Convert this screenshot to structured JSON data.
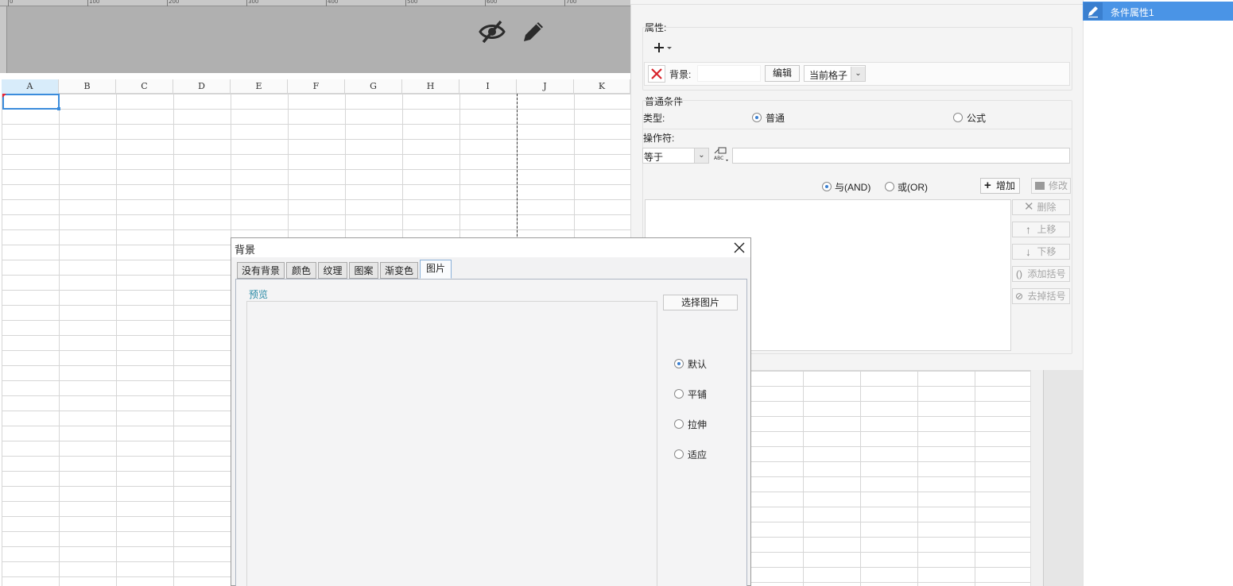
{
  "header": {
    "ruler_labels": [
      "0",
      "100",
      "200",
      "300",
      "400",
      "500",
      "600",
      "700"
    ],
    "hide_icon": "eye-slash-icon",
    "edit_icon": "pencil-icon"
  },
  "sheet": {
    "columns": [
      "A",
      "B",
      "C",
      "D",
      "E",
      "F",
      "G",
      "H",
      "I",
      "J",
      "K"
    ],
    "selected_cell": "A1"
  },
  "cond_panel": {
    "attr_label": "属性:",
    "add_icon": "plus-icon",
    "bg_remove_icon": "red-x-icon",
    "bg_label": "背景:",
    "bg_value": "",
    "edit_btn": "编辑",
    "scope_value": "当前格子",
    "normal_condition_title": "普通条件",
    "type_label": "类型:",
    "type_normal": "普通",
    "type_formula": "公式",
    "type_selected": "普通",
    "operator_label": "操作符:",
    "operator_value": "等于",
    "operand_value": "",
    "and_label": "与(AND)",
    "or_label": "或(OR)",
    "logic_selected": "与(AND)",
    "add_btn": "增加",
    "modify_btn": "修改",
    "delete_btn": "删除",
    "up_btn": "上移",
    "down_btn": "下移",
    "add_bracket_btn": "添加括号",
    "remove_bracket_btn": "去掉括号"
  },
  "right_list": {
    "items": [
      {
        "label": "条件属性1",
        "selected": true
      }
    ]
  },
  "dialog": {
    "title": "背景",
    "tabs": [
      "没有背景",
      "颜色",
      "纹理",
      "图案",
      "渐变色",
      "图片"
    ],
    "active_tab": "图片",
    "preview_label": "预览",
    "choose_image_btn": "选择图片",
    "layout_options": [
      "默认",
      "平铺",
      "拉伸",
      "适应"
    ],
    "layout_selected": "默认"
  },
  "colors": {
    "accent": "#4a94e6",
    "selection": "#3b8cdc",
    "header_gray": "#b0b0b0",
    "legend": "#2a8aa6"
  }
}
